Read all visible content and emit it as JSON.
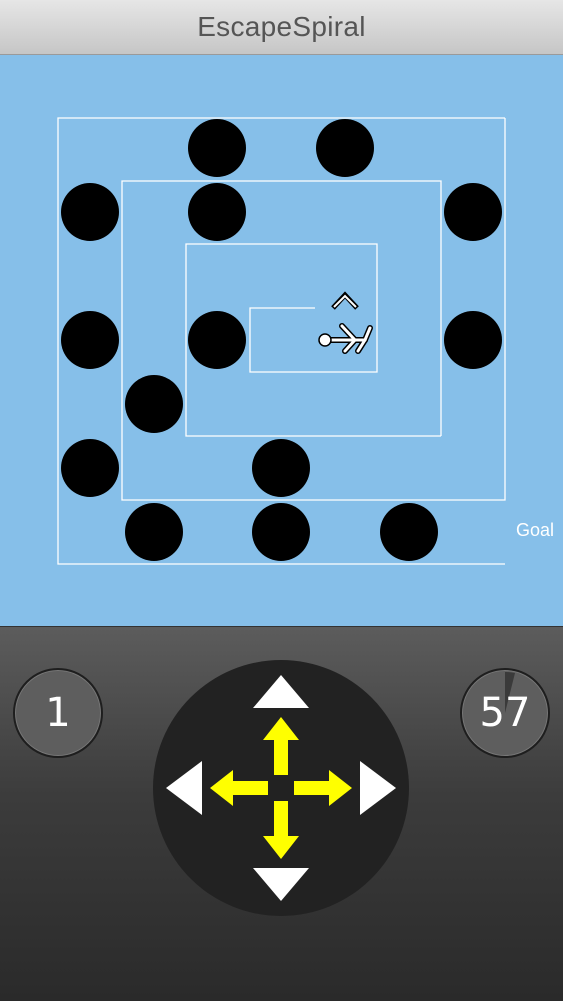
{
  "app": {
    "title": "EscapeSpiral"
  },
  "board": {
    "goal_label": "Goal",
    "colors": {
      "background": "#86bfe9",
      "walls": "#ffffff",
      "obstacles": "#000000"
    },
    "player": {
      "icon": "running-person-icon",
      "facing": "up"
    }
  },
  "controls": {
    "level_counter": "1",
    "timer_value": "57",
    "dpad": {
      "up": "arrow-up-icon",
      "down": "arrow-down-icon",
      "left": "arrow-left-icon",
      "right": "arrow-right-icon",
      "colors": {
        "outer_arrows": "#ffffff",
        "inner_arrows": "#ffff00"
      }
    }
  }
}
